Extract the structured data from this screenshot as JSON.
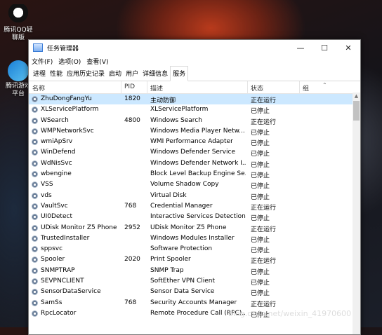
{
  "desktop": {
    "icons": [
      {
        "label": "腾讯QQ轻聊版",
        "icon": "qq-penguin-icon"
      },
      {
        "label": "腾讯游戏平台",
        "icon": "game-platform-icon"
      }
    ]
  },
  "window": {
    "title": "任务管理器",
    "controls": {
      "minimize": "—",
      "maximize": "☐",
      "close": "✕"
    },
    "menu": [
      "文件(F)",
      "选项(O)",
      "查看(V)"
    ],
    "tabs": [
      "进程",
      "性能",
      "应用历史记录",
      "启动",
      "用户",
      "详细信息",
      "服务"
    ],
    "active_tab": "服务",
    "columns": {
      "name": "名称",
      "pid": "PID",
      "desc": "描述",
      "status": "状态",
      "group": "组"
    },
    "services": [
      {
        "name": "ZhuDongFangYu",
        "pid": "1820",
        "desc": "主动防御",
        "status": "正在运行",
        "selected": true
      },
      {
        "name": "XLServicePlatform",
        "pid": "",
        "desc": "XLServicePlatform",
        "status": "已停止"
      },
      {
        "name": "WSearch",
        "pid": "4800",
        "desc": "Windows Search",
        "status": "正在运行"
      },
      {
        "name": "WMPNetworkSvc",
        "pid": "",
        "desc": "Windows Media Player Netw...",
        "status": "已停止"
      },
      {
        "name": "wmiApSrv",
        "pid": "",
        "desc": "WMI Performance Adapter",
        "status": "已停止"
      },
      {
        "name": "WinDefend",
        "pid": "",
        "desc": "Windows Defender Service",
        "status": "已停止"
      },
      {
        "name": "WdNisSvc",
        "pid": "",
        "desc": "Windows Defender Network I...",
        "status": "已停止"
      },
      {
        "name": "wbengine",
        "pid": "",
        "desc": "Block Level Backup Engine Se...",
        "status": "已停止"
      },
      {
        "name": "VSS",
        "pid": "",
        "desc": "Volume Shadow Copy",
        "status": "已停止"
      },
      {
        "name": "vds",
        "pid": "",
        "desc": "Virtual Disk",
        "status": "已停止"
      },
      {
        "name": "VaultSvc",
        "pid": "768",
        "desc": "Credential Manager",
        "status": "正在运行"
      },
      {
        "name": "UI0Detect",
        "pid": "",
        "desc": "Interactive Services Detection",
        "status": "已停止"
      },
      {
        "name": "UDisk Monitor Z5 Phone",
        "pid": "2952",
        "desc": "UDisk Monitor Z5 Phone",
        "status": "正在运行"
      },
      {
        "name": "TrustedInstaller",
        "pid": "",
        "desc": "Windows Modules Installer",
        "status": "已停止"
      },
      {
        "name": "sppsvc",
        "pid": "",
        "desc": "Software Protection",
        "status": "已停止"
      },
      {
        "name": "Spooler",
        "pid": "2020",
        "desc": "Print Spooler",
        "status": "正在运行"
      },
      {
        "name": "SNMPTRAP",
        "pid": "",
        "desc": "SNMP Trap",
        "status": "已停止"
      },
      {
        "name": "SEVPNCLIENT",
        "pid": "",
        "desc": "SoftEther VPN Client",
        "status": "已停止"
      },
      {
        "name": "SensorDataService",
        "pid": "",
        "desc": "Sensor Data Service",
        "status": "已停止"
      },
      {
        "name": "SamSs",
        "pid": "768",
        "desc": "Security Accounts Manager",
        "status": "正在运行"
      },
      {
        "name": "RpcLocator",
        "pid": "",
        "desc": "Remote Procedure Call (RPC)...",
        "status": "已停止"
      }
    ]
  },
  "watermark": "blog.csdn.net/weixin_41970600",
  "colors": {
    "selected_row": "#cce8ff",
    "window_bg": "#ffffff"
  }
}
